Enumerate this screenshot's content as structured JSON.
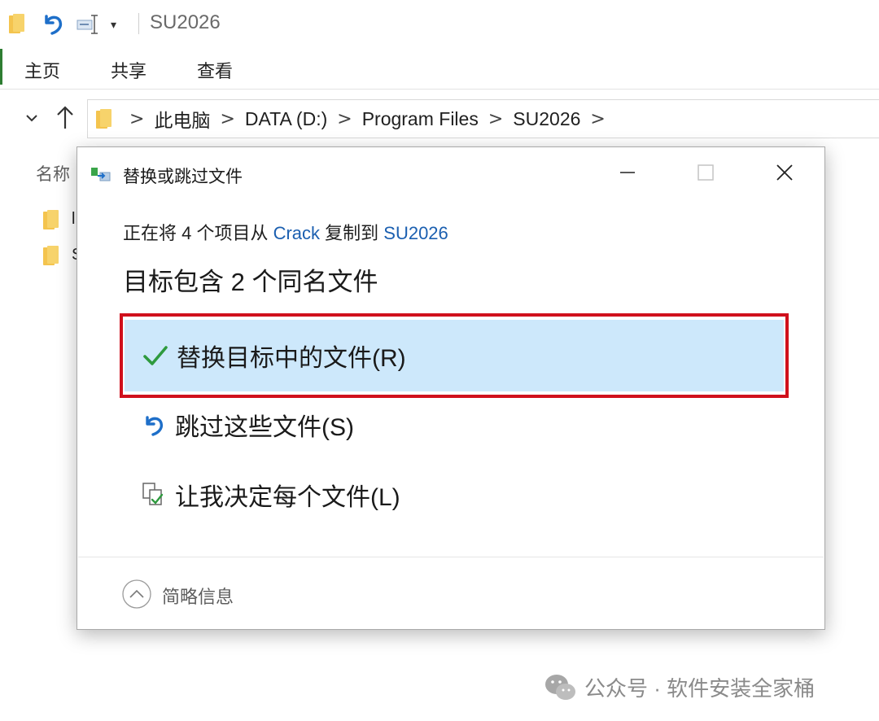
{
  "window": {
    "title": "SU2026",
    "quick_access": {
      "dropdown_glyph": "▾",
      "icons": [
        "folder-icon",
        "undo-icon",
        "properties-icon"
      ]
    }
  },
  "ribbon": {
    "tabs": [
      {
        "label": "主页"
      },
      {
        "label": "共享"
      },
      {
        "label": "查看"
      }
    ]
  },
  "address_bar": {
    "separator": ">",
    "segments": [
      "此电脑",
      "DATA (D:)",
      "Program Files",
      "SU2026"
    ]
  },
  "file_list": {
    "column_name": "名称",
    "rows": [
      {
        "letter": "l"
      },
      {
        "letter": "S"
      }
    ]
  },
  "dialog": {
    "title": "替换或跳过文件",
    "info": {
      "prefix": "正在将 4 个项目从 ",
      "source": "Crack",
      "middle": " 复制到 ",
      "destination": "SU2026"
    },
    "heading": "目标包含 2 个同名文件",
    "options": [
      {
        "label": "替换目标中的文件(R)",
        "icon": "checkmark-icon",
        "selected": true
      },
      {
        "label": "跳过这些文件(S)",
        "icon": "skip-arrow-icon",
        "selected": false
      },
      {
        "label": "让我决定每个文件(L)",
        "icon": "compare-files-icon",
        "selected": false
      }
    ],
    "details_label": "简略信息"
  },
  "watermark": {
    "text": "公众号 · 软件安装全家桶"
  },
  "colors": {
    "selected_option_bg": "#cde8fb",
    "highlight_border": "#d0101c",
    "link": "#1b5fb0",
    "folder": "#f4c44e",
    "check": "#2e9a3e"
  }
}
